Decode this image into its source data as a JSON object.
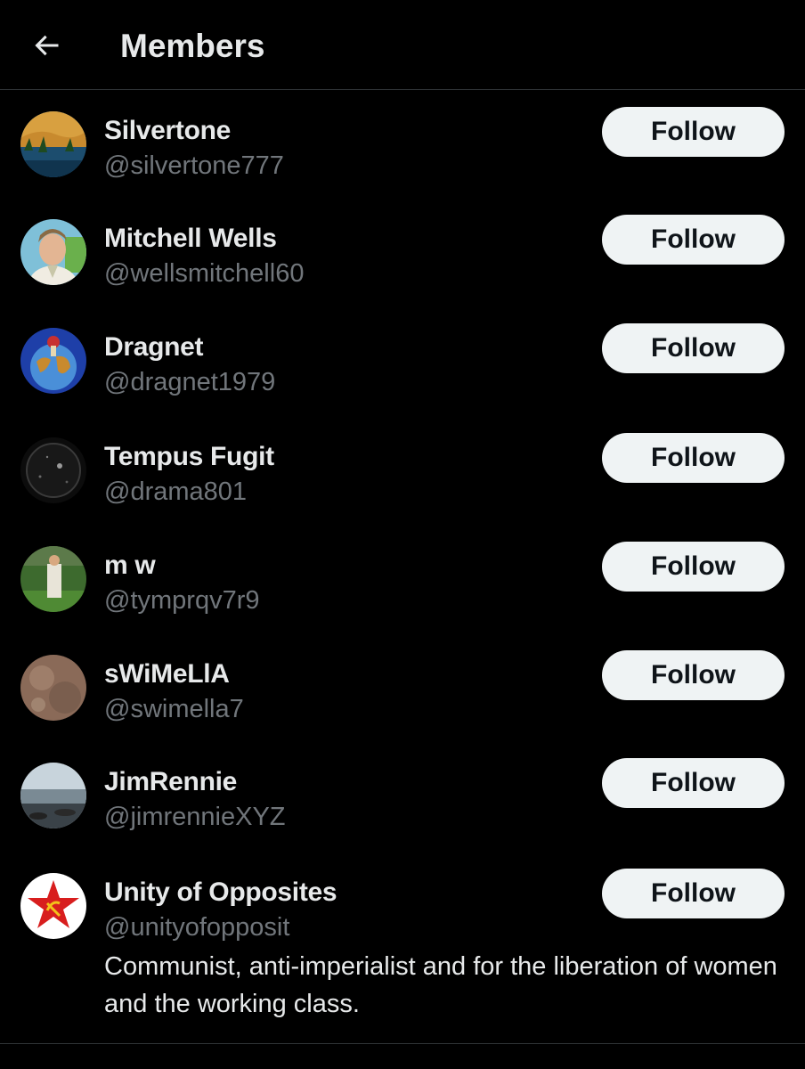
{
  "header": {
    "title": "Members",
    "back_icon": "arrow-left-icon"
  },
  "members": [
    {
      "name": "Silvertone",
      "handle": "@silvertone777",
      "follow_label": "Follow"
    },
    {
      "name": "Mitchell Wells",
      "handle": "@wellsmitchell60",
      "follow_label": "Follow"
    },
    {
      "name": "Dragnet",
      "handle": "@dragnet1979",
      "follow_label": "Follow"
    },
    {
      "name": "Tempus Fugit",
      "handle": "@drama801",
      "follow_label": "Follow"
    },
    {
      "name": "m w",
      "handle": "@tymprqv7r9",
      "follow_label": "Follow"
    },
    {
      "name": "sWiMeLlA",
      "handle": "@swimella7",
      "follow_label": "Follow"
    },
    {
      "name": "JimRennie",
      "handle": "@jimrennieXYZ",
      "follow_label": "Follow"
    },
    {
      "name": "Unity of Opposites",
      "handle": "@unityofopposit",
      "follow_label": "Follow",
      "bio": "Communist, anti-imperialist and for the liberation of women and the working class."
    }
  ],
  "colors": {
    "background": "#000000",
    "text_primary": "#e7e9ea",
    "text_secondary": "#71767b",
    "button_bg": "#eff3f4",
    "button_text": "#0f1419",
    "divider": "#2f3336"
  }
}
